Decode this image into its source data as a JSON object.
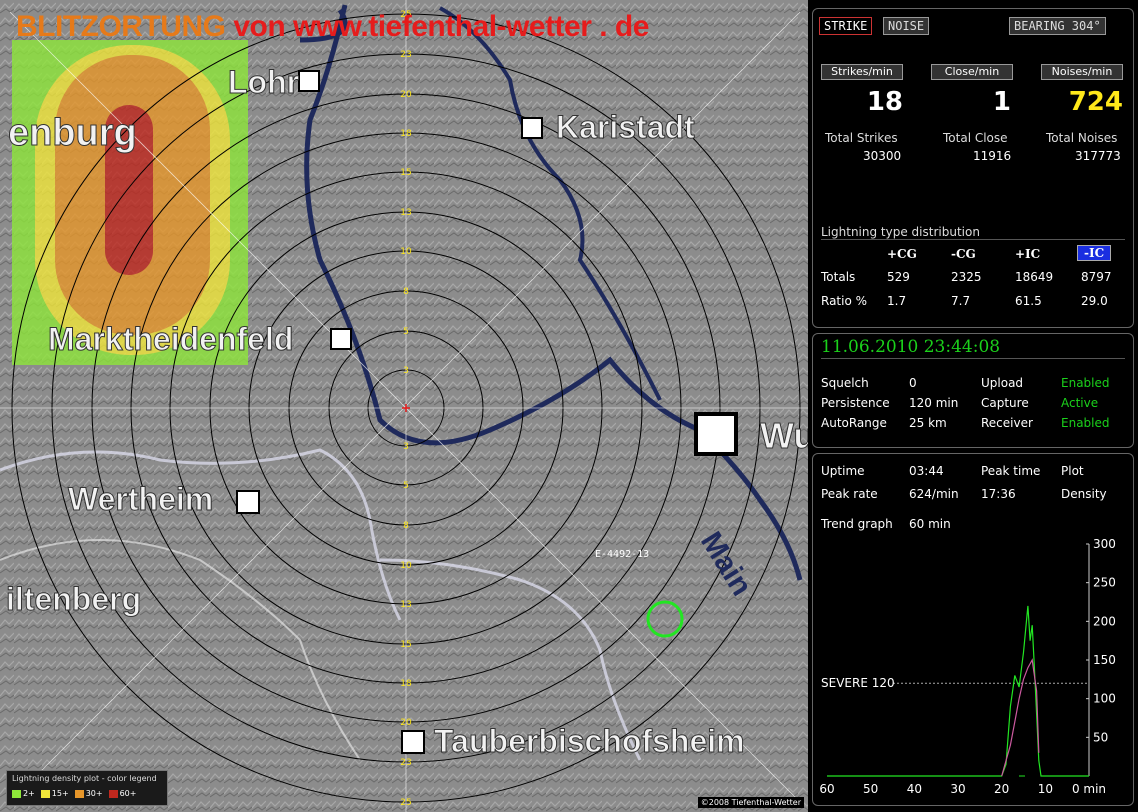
{
  "map": {
    "title_part1": "BLITZORTUNG",
    "title_part2": "von www.tiefenthal-wetter . de",
    "places": [
      "Lohr",
      "Karistadt",
      "enburg",
      "Marktheidenfeld",
      "Wu",
      "Wertheim",
      "iltenberg",
      "Tauberbischofsheim"
    ],
    "river": "Main",
    "station_label": "E-4492-13",
    "range_labels": [
      "3",
      "5",
      "8",
      "10",
      "13",
      "15",
      "18",
      "20",
      "23",
      "25"
    ],
    "legend_title": "Lightning density plot - color legend",
    "legend_items": [
      {
        "label": "2+",
        "color": "#8ee63a"
      },
      {
        "label": "15+",
        "color": "#f0e63a"
      },
      {
        "label": "30+",
        "color": "#e6962a"
      },
      {
        "label": "60+",
        "color": "#c0281e"
      }
    ],
    "copyright": "©2008 Tiefenthal-Wetter"
  },
  "buttons": {
    "strike": "STRIKE",
    "noise": "NOISE",
    "bearing": "BEARING 304°"
  },
  "stats": {
    "strikes_hdr": "Strikes/min",
    "close_hdr": "Close/min",
    "noises_hdr": "Noises/min",
    "strikes": "18",
    "close": "1",
    "noises": "724",
    "total_strikes_label": "Total Strikes",
    "total_close_label": "Total Close",
    "total_noises_label": "Total Noises",
    "total_strikes": "30300",
    "total_close": "11916",
    "total_noises": "317773"
  },
  "dist": {
    "title": "Lightning type distribution",
    "cols": [
      "+CG",
      "-CG",
      "+IC",
      "-IC"
    ],
    "totals_label": "Totals",
    "totals": [
      "529",
      "2325",
      "18649",
      "8797"
    ],
    "ratio_label": "Ratio %",
    "ratio": [
      "1.7",
      "7.7",
      "61.5",
      "29.0"
    ]
  },
  "status": {
    "datetime": "11.06.2010 23:44:08",
    "squelch_label": "Squelch",
    "squelch": "0",
    "persistence_label": "Persistence",
    "persistence": "120 min",
    "autorange_label": "AutoRange",
    "autorange": "25 km",
    "upload_label": "Upload",
    "upload": "Enabled",
    "capture_label": "Capture",
    "capture": "Active",
    "receiver_label": "Receiver",
    "receiver": "Enabled"
  },
  "info": {
    "uptime_label": "Uptime",
    "uptime": "03:44",
    "peaktime_label": "Peak time",
    "peaktime": "",
    "plot_label": "Plot",
    "peakrate_label": "Peak rate",
    "peakrate": "624/min",
    "peakrate_time": "17:36",
    "plot_value": "Density",
    "trend_label": "Trend graph",
    "trend_value": "60 min"
  },
  "chart_data": {
    "type": "line",
    "x_unit": "min",
    "x_ticks": [
      "60",
      "50",
      "40",
      "30",
      "20",
      "10",
      "0 min"
    ],
    "y_ticks": [
      "300",
      "250",
      "200",
      "150",
      "100",
      "50"
    ],
    "ylim": [
      0,
      300
    ],
    "xlim": [
      60,
      0
    ],
    "threshold": {
      "label": "SEVERE 120",
      "value": 120
    },
    "series": [
      {
        "color": "#22e622",
        "x": [
          60,
          20,
          19,
          18,
          17,
          16,
          15,
          14.5,
          14,
          13.5,
          13,
          12.5,
          12,
          11.5,
          11,
          10.5,
          10,
          0
        ],
        "values": [
          0,
          0,
          15,
          90,
          130,
          115,
          160,
          190,
          220,
          175,
          195,
          140,
          80,
          20,
          0,
          0,
          0,
          0
        ]
      },
      {
        "color": "#cc5aa0",
        "x": [
          20,
          18,
          17,
          16,
          15,
          14,
          13,
          12,
          11.5
        ],
        "values": [
          0,
          40,
          70,
          100,
          125,
          140,
          150,
          110,
          30
        ]
      }
    ]
  }
}
